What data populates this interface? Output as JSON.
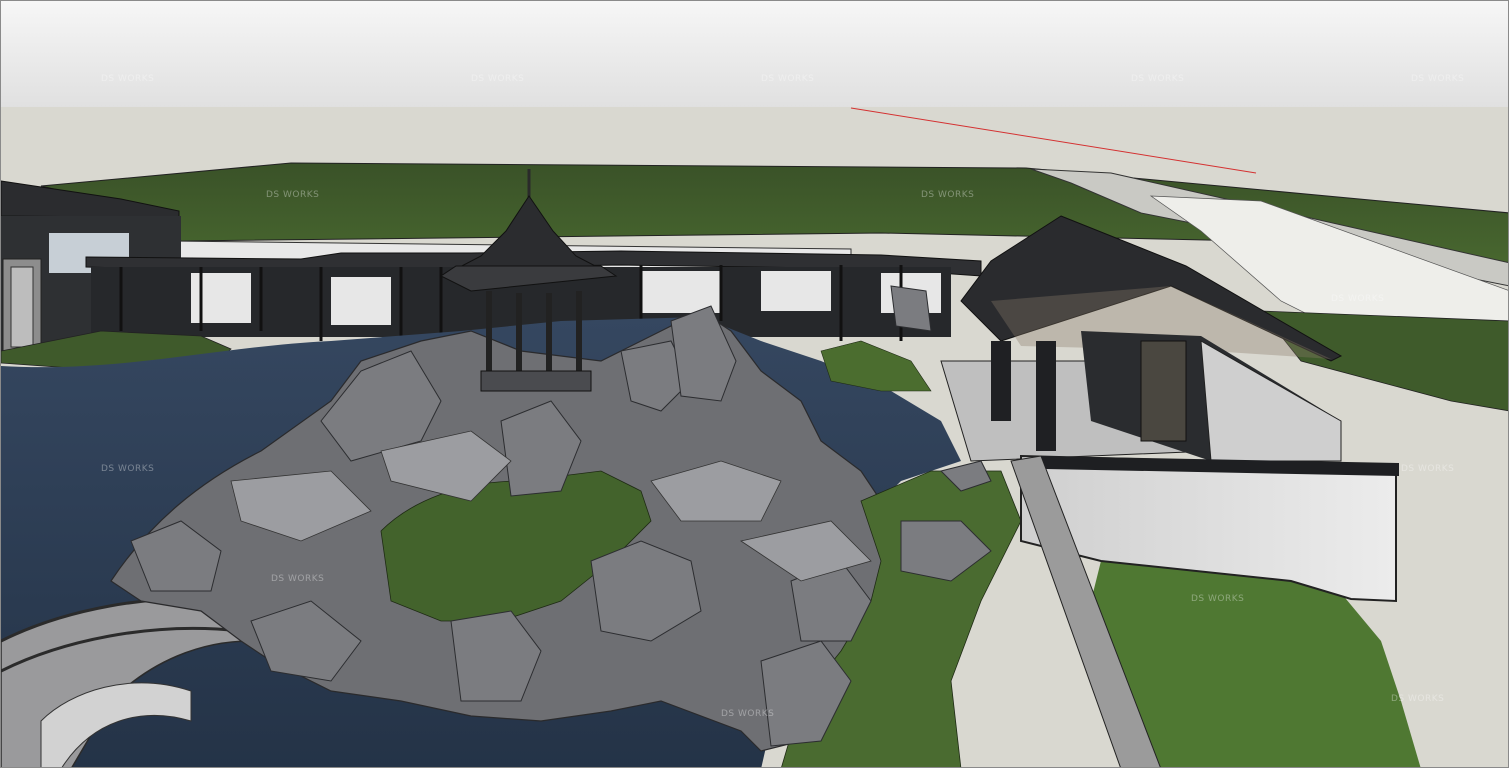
{
  "viewport": {
    "watermark_text": "DS WORKS",
    "colors": {
      "sky_top": "#f4f4f4",
      "sky_bottom": "#e2e2e2",
      "ground": "#d9d8d1",
      "grass": "#3e5a2a",
      "grass_light": "#4f7a33",
      "water": "#2c3d52",
      "rock": "#6f7074",
      "rock_dark": "#3b3c40",
      "roof": "#2a2b2e",
      "wall": "#d8d8d8",
      "axis_red": "#d43131"
    }
  }
}
